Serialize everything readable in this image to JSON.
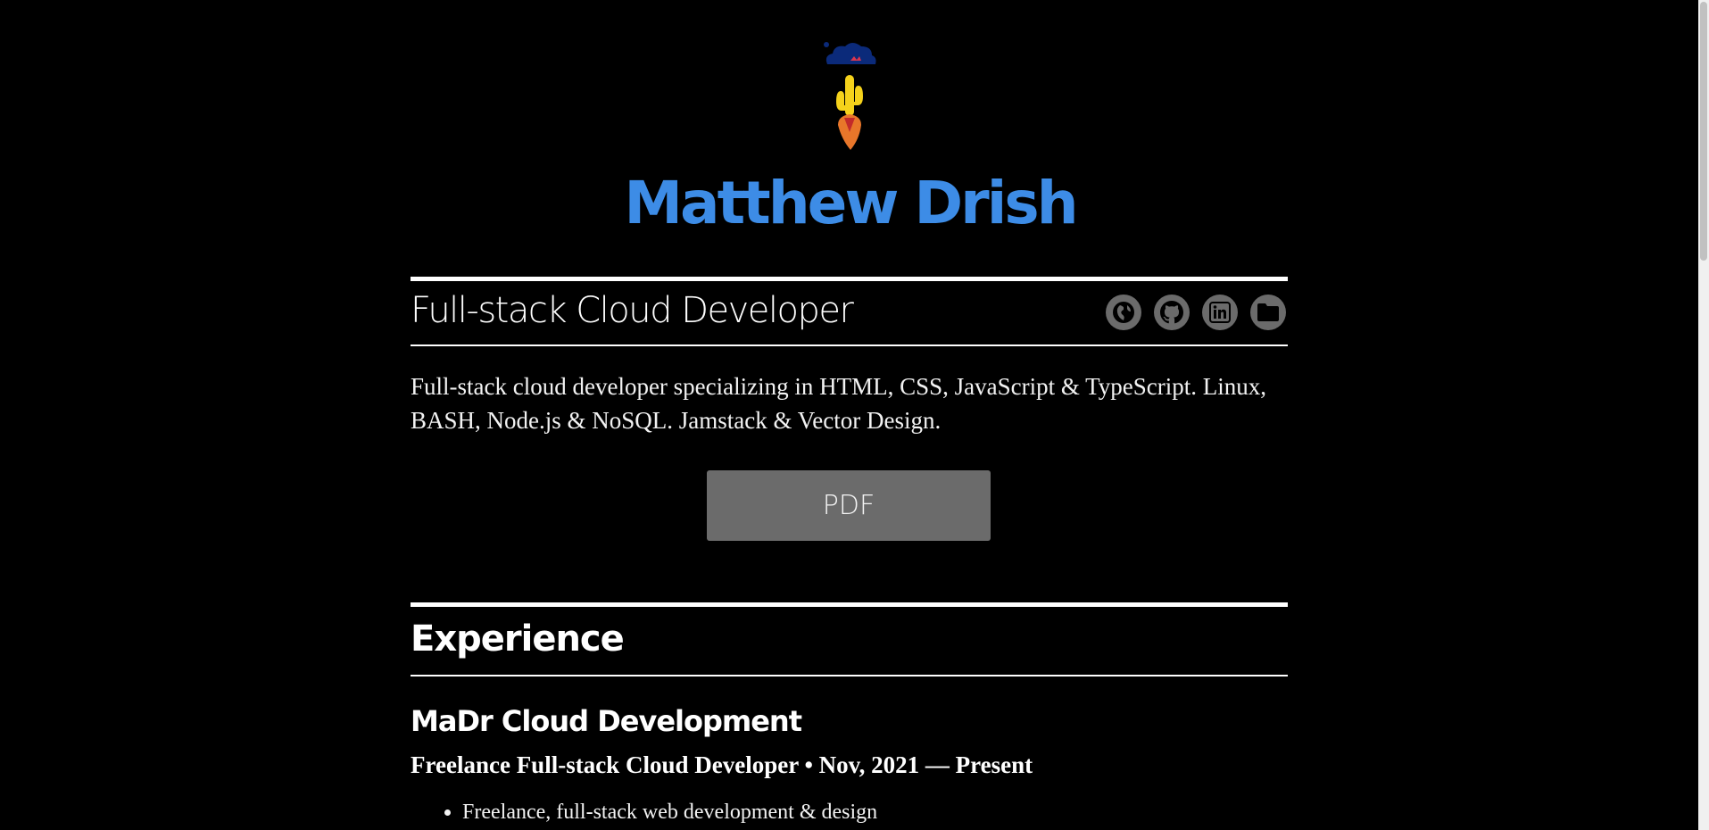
{
  "header": {
    "name": "Matthew Drish",
    "logo_icon": "cactus-rocket-cloud-logo-icon"
  },
  "intro": {
    "title": "Full-stack Cloud Developer",
    "summary": "Full-stack cloud developer specializing in HTML, CSS, JavaScript & TypeScript. Linux, BASH, Node.js & NoSQL. Jamstack & Vector Design.",
    "social_links": [
      {
        "icon": "globe-icon"
      },
      {
        "icon": "github-icon"
      },
      {
        "icon": "linkedin-icon"
      },
      {
        "icon": "folder-icon"
      }
    ],
    "pdf_label": "PDF"
  },
  "experience": {
    "section_title": "Experience",
    "jobs": [
      {
        "company": "MaDr Cloud Development",
        "role": "Freelance Full-stack Cloud Developer • Nov, 2021 — Present",
        "duties": [
          "Freelance, full-stack web development & design"
        ]
      }
    ]
  },
  "colors": {
    "background": "#000000",
    "name_accent": "#3d8ce6",
    "button_gray": "#6b6b6b"
  }
}
